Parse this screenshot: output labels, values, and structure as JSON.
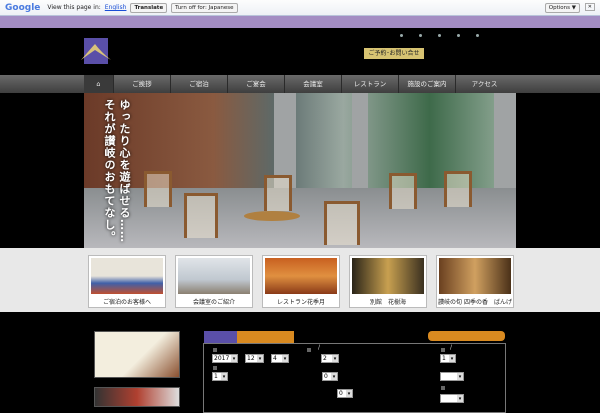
{
  "translate_bar": {
    "logo": "Google",
    "prompt": "View this page in:",
    "language": "English",
    "translate": "Translate",
    "turn_off": "Turn off for: Japanese",
    "options": "Options ▼",
    "close": "✕"
  },
  "header": {
    "reserve": "ご予約･お問い合せ"
  },
  "nav": {
    "items": [
      "ご挨拶",
      "ご宿泊",
      "ご宴会",
      "会議室",
      "レストラン",
      "施設のご案内",
      "アクセス"
    ]
  },
  "hero": {
    "line1": "ゆったり心を遊ばせる……",
    "line2": "それが讃岐のおもてなし。"
  },
  "thumbs": [
    "ご宿泊のお客様へ",
    "会議室のご紹介",
    "レストラン花季月",
    "別館　花樹海",
    "讃岐の旬 四季の香　ばんげ"
  ],
  "form": {
    "year": "2017",
    "month": "12",
    "day": "4",
    "nights": "2",
    "rooms": "1",
    "adults": "1",
    "child1": "0",
    "child2": "0",
    "l1": "/",
    "l2": "/"
  }
}
